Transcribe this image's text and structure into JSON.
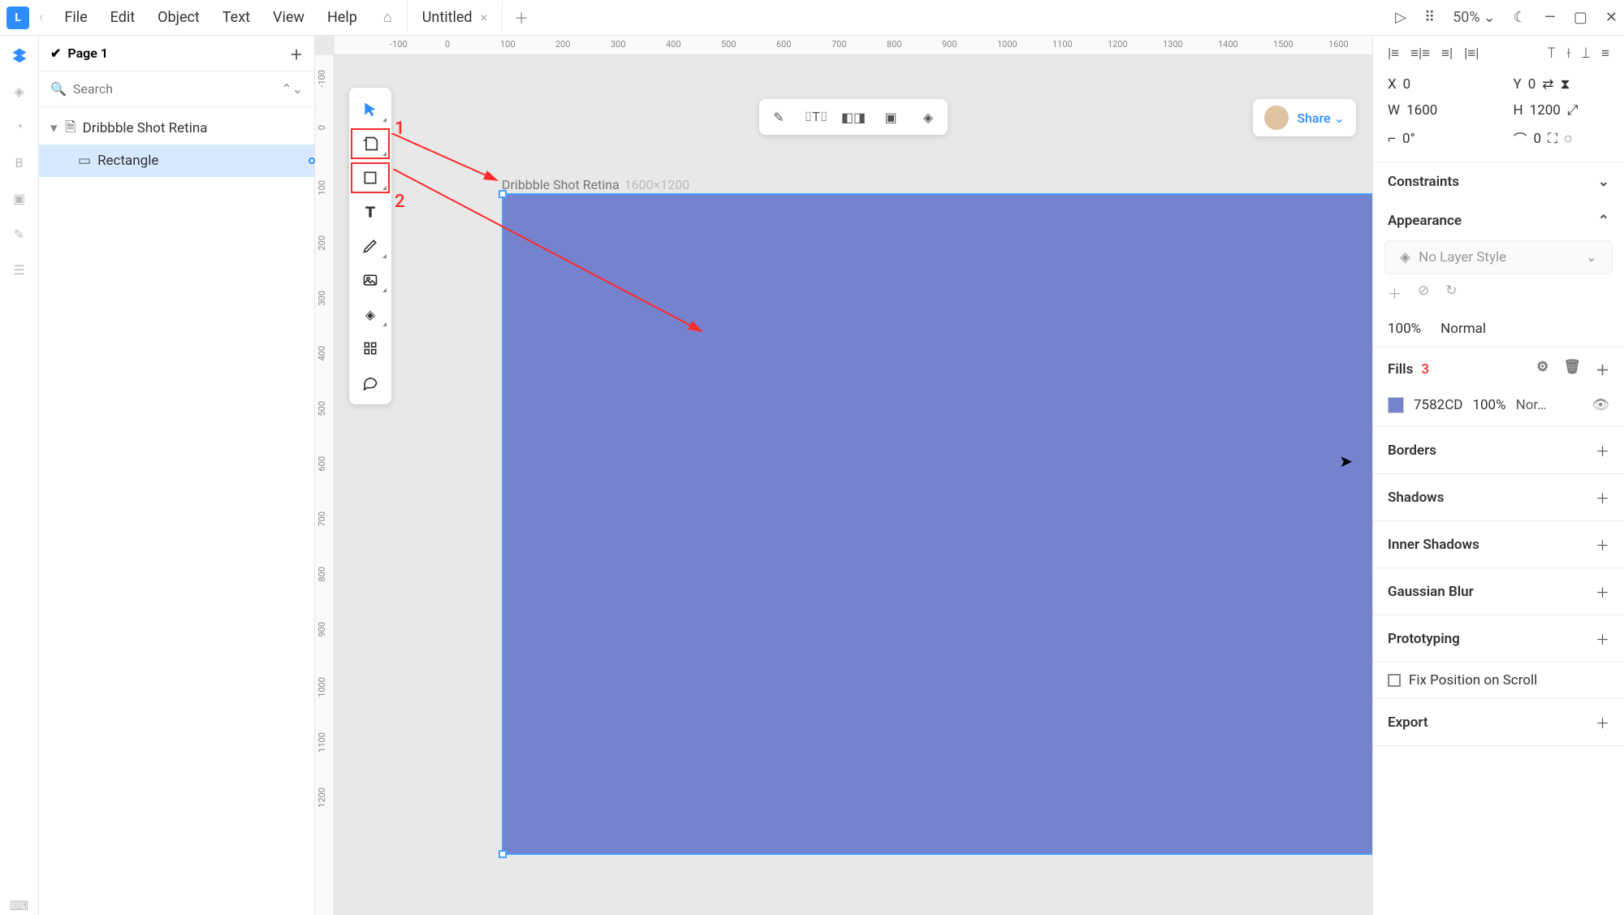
{
  "menubar": {
    "items": [
      "File",
      "Edit",
      "Object",
      "Text",
      "View",
      "Help"
    ],
    "tab_title": "Untitled",
    "zoom": "50%"
  },
  "layers": {
    "page_label": "Page 1",
    "search_placeholder": "Search",
    "root_name": "Dribbble Shot Retina",
    "child_name": "Rectangle"
  },
  "canvas": {
    "frame_name": "Dribbble Shot Retina",
    "frame_dims": "1600×1200",
    "ruler_h": [
      "-100",
      "0",
      "100",
      "200",
      "300",
      "400",
      "500",
      "600",
      "700",
      "800",
      "900",
      "1000",
      "1100",
      "1200",
      "1300",
      "1400",
      "1500",
      "1600"
    ],
    "ruler_v": [
      "-100",
      "0",
      "100",
      "200",
      "300",
      "400",
      "500",
      "600",
      "700",
      "800",
      "900",
      "1000",
      "1100",
      "1200"
    ],
    "share_label": "Share",
    "annotations": {
      "a1": "1",
      "a2": "2",
      "a3": "3"
    }
  },
  "inspector": {
    "pos": {
      "x_label": "X",
      "x": "0",
      "y_label": "Y",
      "y": "0"
    },
    "size": {
      "w_label": "W",
      "w": "1600",
      "h_label": "H",
      "h": "1200"
    },
    "rot": {
      "ang_label": "⌐",
      "ang": "0°",
      "rad_label": "⌒",
      "rad": "0"
    },
    "constraints_label": "Constraints",
    "appearance_label": "Appearance",
    "no_layer_style": "No Layer Style",
    "opacity": "100%",
    "blend": "Normal",
    "fills_label": "Fills",
    "fill_hex": "7582CD",
    "fill_opacity": "100%",
    "fill_mode": "Nor…",
    "borders_label": "Borders",
    "shadows_label": "Shadows",
    "inner_shadows_label": "Inner Shadows",
    "blur_label": "Gaussian Blur",
    "prototyping_label": "Prototyping",
    "fix_scroll_label": "Fix Position on Scroll",
    "export_label": "Export"
  }
}
